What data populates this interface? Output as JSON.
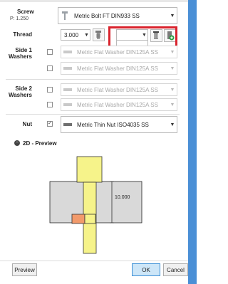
{
  "screw": {
    "label": "Screw",
    "pitch": "P: 1.250",
    "value": "Metric Bolt FT DIN933 SS"
  },
  "thread": {
    "label": "Thread",
    "value": "3.000"
  },
  "side1": {
    "label_line1": "Side 1",
    "label_line2": "Washers",
    "rows": [
      {
        "value": "Metric Flat Washer DIN125A SS"
      },
      {
        "value": "Metric Flat Washer DIN125A SS"
      }
    ]
  },
  "side2": {
    "label_line1": "Side 2",
    "label_line2": "Washers",
    "rows": [
      {
        "value": "Metric Flat Washer DIN125A SS"
      },
      {
        "value": "Metric Flat Washer DIN125A SS"
      }
    ]
  },
  "nut": {
    "label": "Nut",
    "value": "Metric Thin Nut ISO4035 SS",
    "checked": true
  },
  "preview": {
    "section_title": "2D - Preview",
    "dimension": "10.000"
  },
  "footer": {
    "preview_button": "Preview",
    "ok_button": "OK",
    "cancel_button": "Cancel"
  },
  "colors": {
    "bolt": "#f6f38a",
    "plate": "#d9d9d9",
    "washer": "#f29a6b",
    "highlight": "#d9232d",
    "primary": "#3c8fd6"
  }
}
